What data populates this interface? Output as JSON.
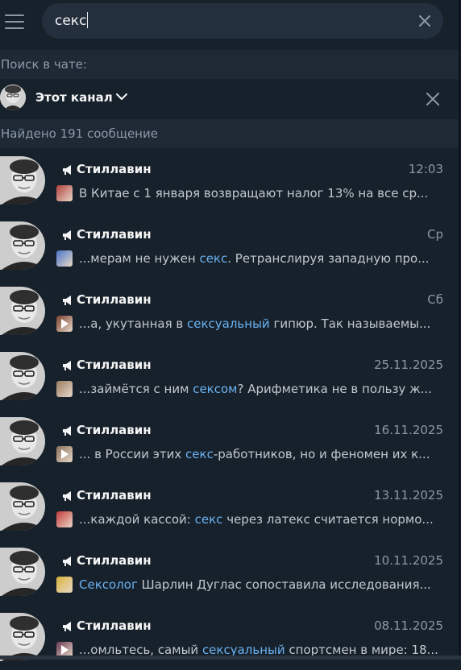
{
  "search": {
    "query": "секс",
    "clear_icon": "close-icon"
  },
  "filters": {
    "section_label": "Поиск в чате:",
    "channel_name": "Этот канал",
    "found_label": "Найдено 191 сообщение"
  },
  "colors": {
    "background": "#17212b",
    "section_background": "#1f2936",
    "highlight": "#6ab2f2",
    "muted_text": "#8b99a6"
  },
  "results": [
    {
      "name": "Стиллавин",
      "time": "12:03",
      "pre": "В Китае с 1 января возвращают налог 13% на все ср...",
      "hl": "",
      "post": "",
      "thumb": "photo",
      "thumb_color": "#b0413e"
    },
    {
      "name": "Стиллавин",
      "time": "Ср",
      "pre": "...мерам не нужен ",
      "hl": "секс",
      "post": ".  Ретранслируя западную про...",
      "thumb": "photo",
      "thumb_color": "#4a74c9"
    },
    {
      "name": "Стиллавин",
      "time": "Сб",
      "pre": "...а, укутанная в ",
      "hl": "сексуальный",
      "post": " гипюр.  Так называемы...",
      "thumb": "video",
      "thumb_color": "#7a3f2e"
    },
    {
      "name": "Стиллавин",
      "time": "25.11.2025",
      "pre": "...займётся с ним ",
      "hl": "сексом",
      "post": "? Арифметика не в пользу ж...",
      "thumb": "photo",
      "thumb_color": "#9a7b62"
    },
    {
      "name": "Стиллавин",
      "time": "16.11.2025",
      "pre": "... в России этих ",
      "hl": "секс",
      "post": "-работников, но и феномен их к...",
      "thumb": "video",
      "thumb_color": "#8a6f5a"
    },
    {
      "name": "Стиллавин",
      "time": "13.11.2025",
      "pre": "...каждой кассой: ",
      "hl": "секс",
      "post": " через латекс считается нормо...",
      "thumb": "photo",
      "thumb_color": "#c43a3a"
    },
    {
      "name": "Стиллавин",
      "time": "10.11.2025",
      "pre": "",
      "hl": "Сексолог",
      "post": " Шарлин Дуглас сопоставила исследования...",
      "thumb": "photo",
      "thumb_color": "#d9b23c"
    },
    {
      "name": "Стиллавин",
      "time": "08.11.2025",
      "pre": "...омльтесь, самый ",
      "hl": "сексуальный",
      "post": " спортсмен в мире: 18...",
      "thumb": "video",
      "thumb_color": "#6a3a52"
    }
  ]
}
